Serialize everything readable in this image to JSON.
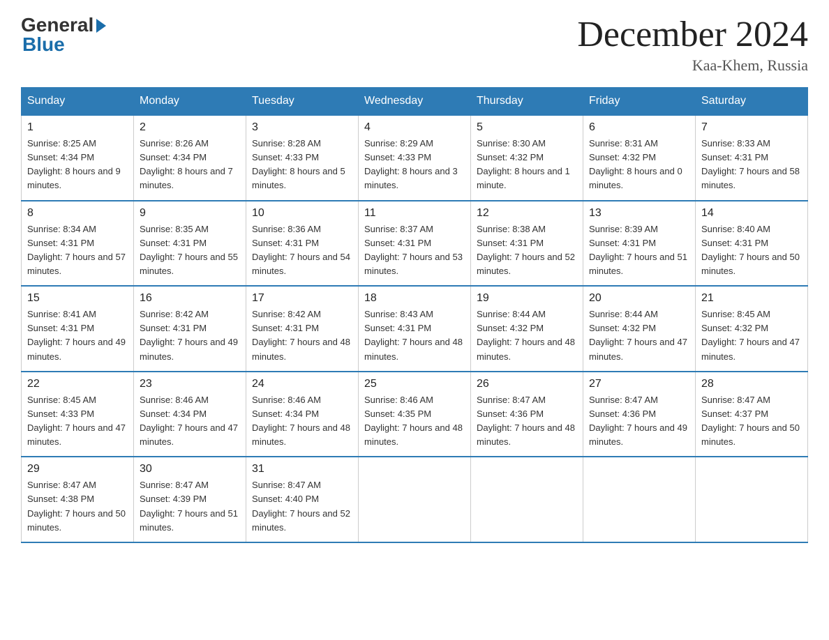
{
  "header": {
    "logo_general": "General",
    "logo_blue": "Blue",
    "month_title": "December 2024",
    "location": "Kaa-Khem, Russia"
  },
  "days_of_week": [
    "Sunday",
    "Monday",
    "Tuesday",
    "Wednesday",
    "Thursday",
    "Friday",
    "Saturday"
  ],
  "weeks": [
    [
      {
        "num": "1",
        "sunrise": "8:25 AM",
        "sunset": "4:34 PM",
        "daylight": "8 hours and 9 minutes."
      },
      {
        "num": "2",
        "sunrise": "8:26 AM",
        "sunset": "4:34 PM",
        "daylight": "8 hours and 7 minutes."
      },
      {
        "num": "3",
        "sunrise": "8:28 AM",
        "sunset": "4:33 PM",
        "daylight": "8 hours and 5 minutes."
      },
      {
        "num": "4",
        "sunrise": "8:29 AM",
        "sunset": "4:33 PM",
        "daylight": "8 hours and 3 minutes."
      },
      {
        "num": "5",
        "sunrise": "8:30 AM",
        "sunset": "4:32 PM",
        "daylight": "8 hours and 1 minute."
      },
      {
        "num": "6",
        "sunrise": "8:31 AM",
        "sunset": "4:32 PM",
        "daylight": "8 hours and 0 minutes."
      },
      {
        "num": "7",
        "sunrise": "8:33 AM",
        "sunset": "4:31 PM",
        "daylight": "7 hours and 58 minutes."
      }
    ],
    [
      {
        "num": "8",
        "sunrise": "8:34 AM",
        "sunset": "4:31 PM",
        "daylight": "7 hours and 57 minutes."
      },
      {
        "num": "9",
        "sunrise": "8:35 AM",
        "sunset": "4:31 PM",
        "daylight": "7 hours and 55 minutes."
      },
      {
        "num": "10",
        "sunrise": "8:36 AM",
        "sunset": "4:31 PM",
        "daylight": "7 hours and 54 minutes."
      },
      {
        "num": "11",
        "sunrise": "8:37 AM",
        "sunset": "4:31 PM",
        "daylight": "7 hours and 53 minutes."
      },
      {
        "num": "12",
        "sunrise": "8:38 AM",
        "sunset": "4:31 PM",
        "daylight": "7 hours and 52 minutes."
      },
      {
        "num": "13",
        "sunrise": "8:39 AM",
        "sunset": "4:31 PM",
        "daylight": "7 hours and 51 minutes."
      },
      {
        "num": "14",
        "sunrise": "8:40 AM",
        "sunset": "4:31 PM",
        "daylight": "7 hours and 50 minutes."
      }
    ],
    [
      {
        "num": "15",
        "sunrise": "8:41 AM",
        "sunset": "4:31 PM",
        "daylight": "7 hours and 49 minutes."
      },
      {
        "num": "16",
        "sunrise": "8:42 AM",
        "sunset": "4:31 PM",
        "daylight": "7 hours and 49 minutes."
      },
      {
        "num": "17",
        "sunrise": "8:42 AM",
        "sunset": "4:31 PM",
        "daylight": "7 hours and 48 minutes."
      },
      {
        "num": "18",
        "sunrise": "8:43 AM",
        "sunset": "4:31 PM",
        "daylight": "7 hours and 48 minutes."
      },
      {
        "num": "19",
        "sunrise": "8:44 AM",
        "sunset": "4:32 PM",
        "daylight": "7 hours and 48 minutes."
      },
      {
        "num": "20",
        "sunrise": "8:44 AM",
        "sunset": "4:32 PM",
        "daylight": "7 hours and 47 minutes."
      },
      {
        "num": "21",
        "sunrise": "8:45 AM",
        "sunset": "4:32 PM",
        "daylight": "7 hours and 47 minutes."
      }
    ],
    [
      {
        "num": "22",
        "sunrise": "8:45 AM",
        "sunset": "4:33 PM",
        "daylight": "7 hours and 47 minutes."
      },
      {
        "num": "23",
        "sunrise": "8:46 AM",
        "sunset": "4:34 PM",
        "daylight": "7 hours and 47 minutes."
      },
      {
        "num": "24",
        "sunrise": "8:46 AM",
        "sunset": "4:34 PM",
        "daylight": "7 hours and 48 minutes."
      },
      {
        "num": "25",
        "sunrise": "8:46 AM",
        "sunset": "4:35 PM",
        "daylight": "7 hours and 48 minutes."
      },
      {
        "num": "26",
        "sunrise": "8:47 AM",
        "sunset": "4:36 PM",
        "daylight": "7 hours and 48 minutes."
      },
      {
        "num": "27",
        "sunrise": "8:47 AM",
        "sunset": "4:36 PM",
        "daylight": "7 hours and 49 minutes."
      },
      {
        "num": "28",
        "sunrise": "8:47 AM",
        "sunset": "4:37 PM",
        "daylight": "7 hours and 50 minutes."
      }
    ],
    [
      {
        "num": "29",
        "sunrise": "8:47 AM",
        "sunset": "4:38 PM",
        "daylight": "7 hours and 50 minutes."
      },
      {
        "num": "30",
        "sunrise": "8:47 AM",
        "sunset": "4:39 PM",
        "daylight": "7 hours and 51 minutes."
      },
      {
        "num": "31",
        "sunrise": "8:47 AM",
        "sunset": "4:40 PM",
        "daylight": "7 hours and 52 minutes."
      },
      null,
      null,
      null,
      null
    ]
  ],
  "labels": {
    "sunrise": "Sunrise:",
    "sunset": "Sunset:",
    "daylight": "Daylight:"
  }
}
